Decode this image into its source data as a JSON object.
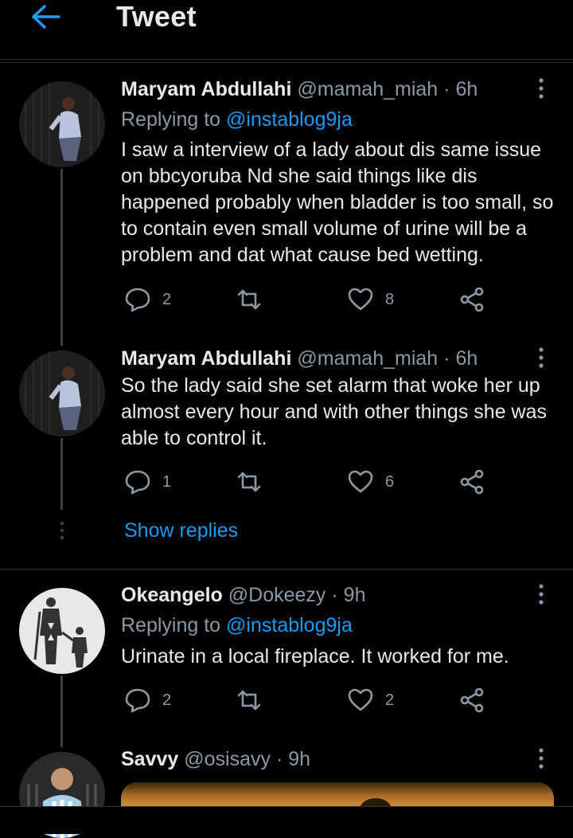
{
  "header": {
    "title": "Tweet"
  },
  "colors": {
    "accent": "#1d9bf0",
    "muted": "#8b98a5",
    "text": "#e7e9ea",
    "background": "#000000"
  },
  "tweets": [
    {
      "name": "Maryam Abdullahi",
      "handle": "@mamah_miah",
      "sep": "·",
      "time": "6h",
      "replying_prefix": "Replying to ",
      "replying_to": "@instablog9ja",
      "text": "I saw a interview of a lady about dis same issue on bbcyoruba Nd she said things like dis happened probably when bladder is too small, so to contain even small volume of urine will be a problem and dat what cause bed wetting.",
      "replies": "2",
      "likes": "8"
    },
    {
      "name": "Maryam Abdullahi",
      "handle": "@mamah_miah",
      "sep": "·",
      "time": "6h",
      "text": "So the lady said she set alarm that woke her up almost every hour and with other things she was able to control it.",
      "replies": "1",
      "likes": "6"
    },
    {
      "name": "Okeangelo",
      "handle": "@Dokeezy",
      "sep": "·",
      "time": "9h",
      "replying_prefix": "Replying to ",
      "replying_to": "@instablog9ja",
      "text": "Urinate in a local fireplace. It worked for me.",
      "replies": "2",
      "likes": "2"
    },
    {
      "name": "Savvy",
      "handle": "@osisavy",
      "sep": "·",
      "time": "9h"
    }
  ],
  "show_replies": "Show replies",
  "icons": [
    "back-arrow-icon",
    "more-vertical-icon",
    "reply-icon",
    "retweet-icon",
    "like-icon",
    "share-icon"
  ]
}
